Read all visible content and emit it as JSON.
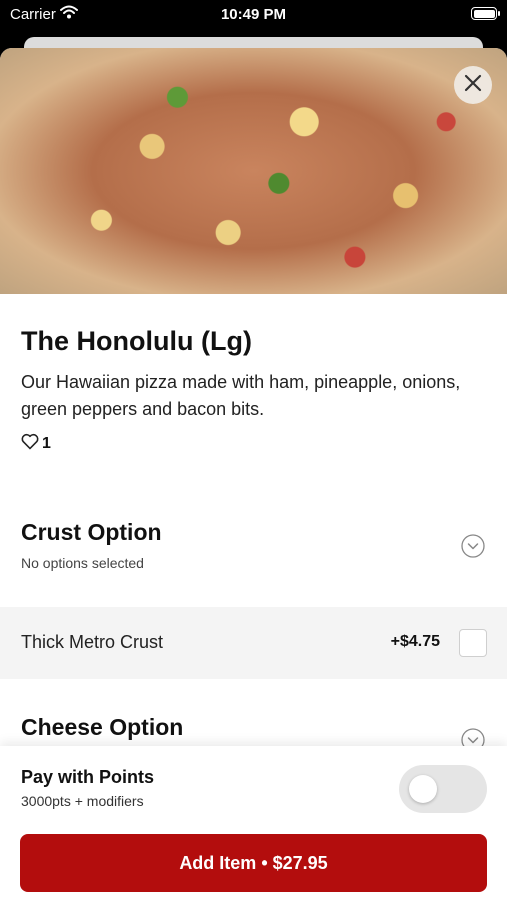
{
  "status_bar": {
    "carrier": "Carrier",
    "time": "10:49 PM"
  },
  "item": {
    "title": "The Honolulu (Lg)",
    "description": "Our Hawaiian pizza made with ham, pineapple, onions, green peppers and bacon bits.",
    "likes": "1"
  },
  "crust_section": {
    "title": "Crust Option",
    "subtitle": "No options selected",
    "options": [
      {
        "label": "Thick Metro Crust",
        "price": "+$4.75",
        "checked": false
      }
    ]
  },
  "cheese_section": {
    "title": "Cheese Option"
  },
  "footer": {
    "points_title": "Pay with Points",
    "points_subtitle": "3000pts + modifiers",
    "toggle_on": false,
    "add_button": "Add Item • $27.95"
  },
  "colors": {
    "primary": "#b30d0d",
    "option_row_bg": "#f4f4f4",
    "toggle_off": "#e5e5e5"
  },
  "icons": [
    "wifi-icon",
    "battery-icon",
    "close-icon",
    "heart-icon",
    "chevron-down-icon"
  ]
}
